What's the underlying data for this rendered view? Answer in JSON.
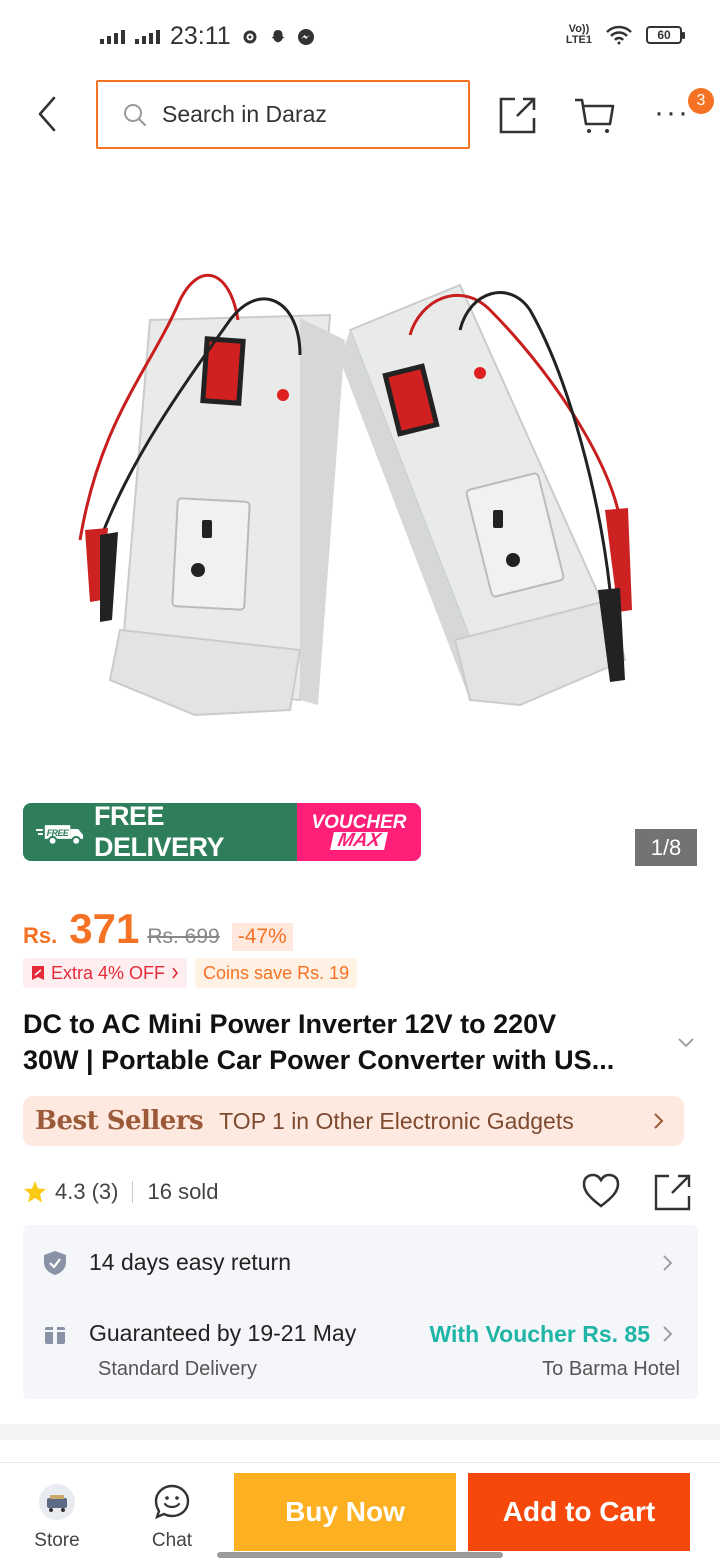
{
  "status_bar": {
    "time": "23:11",
    "volte": "VoLTE1",
    "battery": "60"
  },
  "header": {
    "search_placeholder": "Search in Daraz",
    "cart_badge": "3",
    "more_label": "···"
  },
  "gallery": {
    "counter": "1/8",
    "promo_free_small": "FREE",
    "promo_free_delivery": "FREE DELIVERY",
    "promo_voucher": "VOUCHER",
    "promo_max": "MAX"
  },
  "price": {
    "currency": "Rs.",
    "current": "371",
    "original": "Rs. 699",
    "discount": "-47%"
  },
  "tags": {
    "extra_off": "Extra 4% OFF",
    "coins": "Coins save Rs. 19"
  },
  "product": {
    "title_line1": "DC to AC Mini Power Inverter 12V to 220V",
    "title_line2": "30W | Portable Car Power Converter with US..."
  },
  "best_sellers": {
    "label": "Best Sellers",
    "text": "TOP 1 in Other Electronic Gadgets"
  },
  "rating": {
    "value": "4.3",
    "count": "(3)",
    "sold": "16 sold",
    "stars": 4.3
  },
  "delivery": {
    "return_text": "14 days easy return",
    "guarantee_text": "Guaranteed by 19-21 May",
    "voucher_text": "With Voucher Rs. 85",
    "standard": "Standard Delivery",
    "location": "To Barma Hotel"
  },
  "bottom_bar": {
    "store": "Store",
    "chat": "Chat",
    "buy_now": "Buy Now",
    "add_to_cart": "Add to Cart"
  },
  "colors": {
    "accent": "#f57224",
    "buy_now": "#fdb022",
    "add_to_cart": "#f5480a",
    "voucher_teal": "#1fb5a6",
    "free_delivery_green": "#2e7d5b",
    "voucher_max_pink": "#ff1f78"
  }
}
